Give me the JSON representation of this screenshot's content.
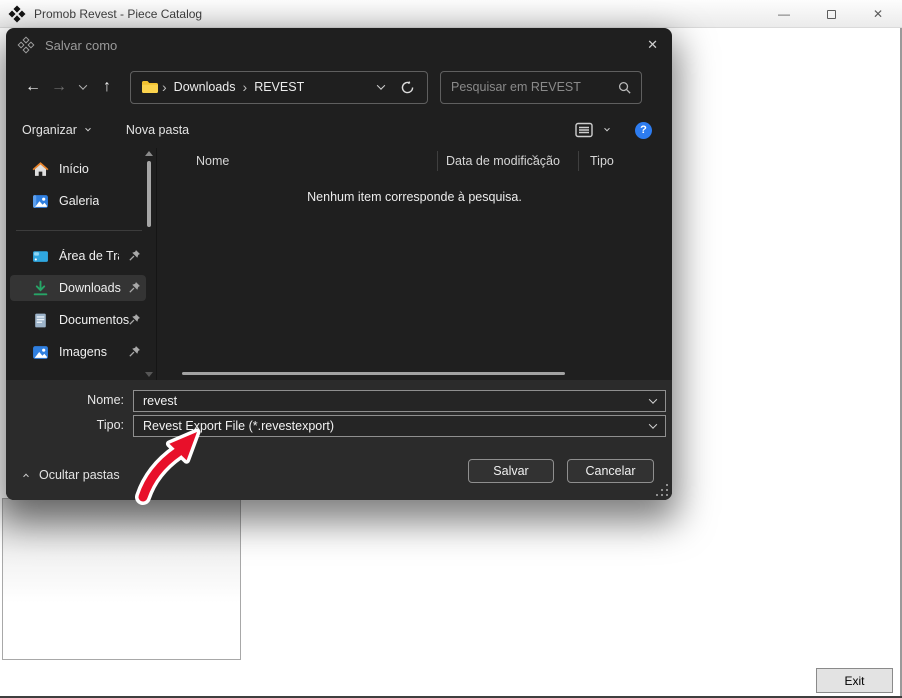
{
  "colors": {
    "arrow_red": "#e8102a",
    "help_blue": "#2d7cf0",
    "folder_yellow": "#f2c230",
    "download_green": "#27a567",
    "dialog_bg": "#1f1f1f",
    "dialog_footer_bg": "#2b2b2b"
  },
  "window": {
    "title": "Promob Revest - Piece Catalog",
    "icons": {
      "minimize_glyph": "—",
      "close_glyph": "✕"
    },
    "exit_label": "Exit"
  },
  "dialog": {
    "title": "Salvar como",
    "icons": {
      "close_glyph": "✕",
      "back_glyph": "←",
      "forward_glyph": "→",
      "up_glyph": "↑",
      "breadcrumb_separator": "›",
      "help_glyph": "?"
    },
    "address": {
      "crumbs": [
        "Downloads",
        "REVEST"
      ]
    },
    "search": {
      "placeholder": "Pesquisar em REVEST"
    },
    "toolbar": {
      "organize_label": "Organizar",
      "new_folder_label": "Nova pasta"
    },
    "sidebar": {
      "items": [
        {
          "label": "Início"
        },
        {
          "label": "Galeria"
        },
        {
          "label": "Área de Trabalho"
        },
        {
          "label": "Downloads"
        },
        {
          "label": "Documentos"
        },
        {
          "label": "Imagens"
        }
      ]
    },
    "list": {
      "columns": [
        "Nome",
        "Data de modificação",
        "Tipo"
      ],
      "empty_message": "Nenhum item corresponde à pesquisa."
    },
    "fields": {
      "name_label": "Nome:",
      "name_value": "revest",
      "type_label": "Tipo:",
      "type_value": "Revest Export File (*.revestexport)"
    },
    "footer": {
      "hide_folders_label": "Ocultar pastas",
      "save_label": "Salvar",
      "cancel_label": "Cancelar"
    }
  }
}
